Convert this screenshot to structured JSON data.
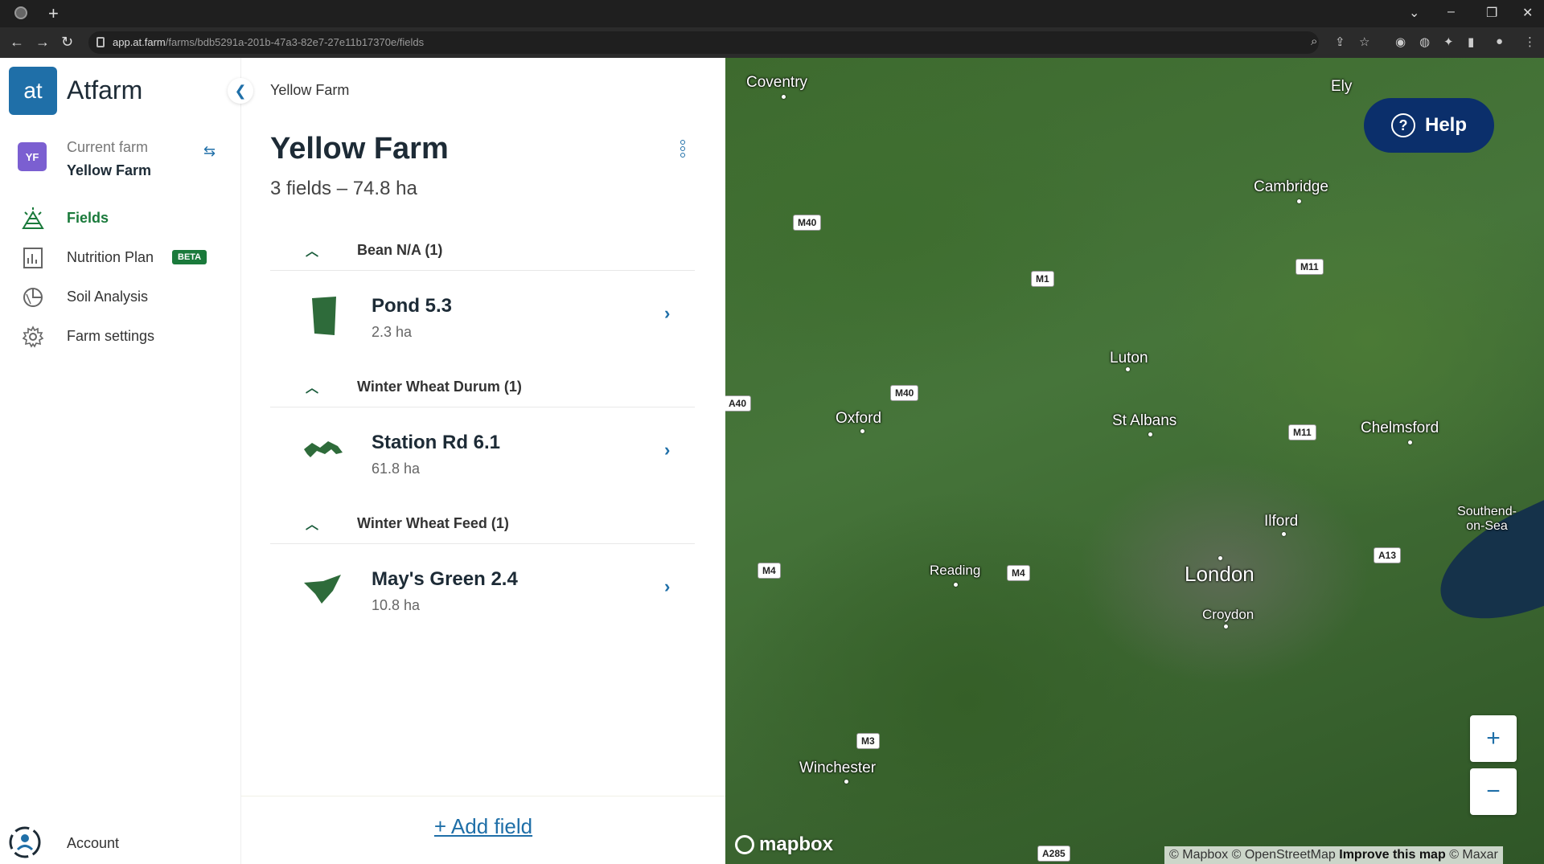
{
  "browser": {
    "url_domain": "app.at.farm",
    "url_path": "/farms/bdb5291a-201b-47a3-82e7-27e11b17370e/fields"
  },
  "nav": {
    "logo_text": "at",
    "brand": "Atfarm",
    "farm_initials": "YF",
    "current_farm_label": "Current farm",
    "current_farm_name": "Yellow Farm",
    "items": [
      {
        "label": "Fields",
        "icon": "fields-icon",
        "active": true
      },
      {
        "label": "Nutrition Plan",
        "icon": "chart-icon",
        "badge": "BETA"
      },
      {
        "label": "Soil Analysis",
        "icon": "soil-icon"
      },
      {
        "label": "Farm settings",
        "icon": "gear-icon"
      }
    ],
    "account_label": "Account"
  },
  "panel": {
    "breadcrumb": "Yellow Farm",
    "title": "Yellow Farm",
    "subtitle": "3 fields – 74.8 ha",
    "groups": [
      {
        "title": "Bean N/A (1)",
        "fields": [
          {
            "name": "Pond 5.3",
            "area": "2.3 ha"
          }
        ]
      },
      {
        "title": "Winter Wheat Durum (1)",
        "fields": [
          {
            "name": "Station Rd 6.1",
            "area": "61.8 ha"
          }
        ]
      },
      {
        "title": "Winter Wheat Feed (1)",
        "fields": [
          {
            "name": "May's Green 2.4",
            "area": "10.8 ha"
          }
        ]
      }
    ],
    "add_field": "+ Add field"
  },
  "map": {
    "help_label": "Help",
    "zoom_in": "+",
    "zoom_out": "−",
    "logo": "mapbox",
    "attribution": {
      "mapbox": "© Mapbox",
      "osm": "© OpenStreetMap",
      "improve": "Improve this map",
      "maxar": "© Maxar"
    },
    "cities": {
      "coventry": "Coventry",
      "ely": "Ely",
      "cambridge": "Cambridge",
      "luton": "Luton",
      "oxford": "Oxford",
      "st_albans": "St Albans",
      "chelmsford": "Chelmsford",
      "ilford": "Ilford",
      "southend": "Southend-on-Sea",
      "reading": "Reading",
      "london": "London",
      "croydon": "Croydon",
      "winchester": "Winchester"
    },
    "roads": {
      "m40_a": "M40",
      "m1": "M1",
      "m11_a": "M11",
      "m40_b": "M40",
      "m11_b": "M11",
      "a40": "A40",
      "m4_a": "M4",
      "m4_b": "M4",
      "a13": "A13",
      "m3": "M3",
      "a285": "A285"
    }
  }
}
